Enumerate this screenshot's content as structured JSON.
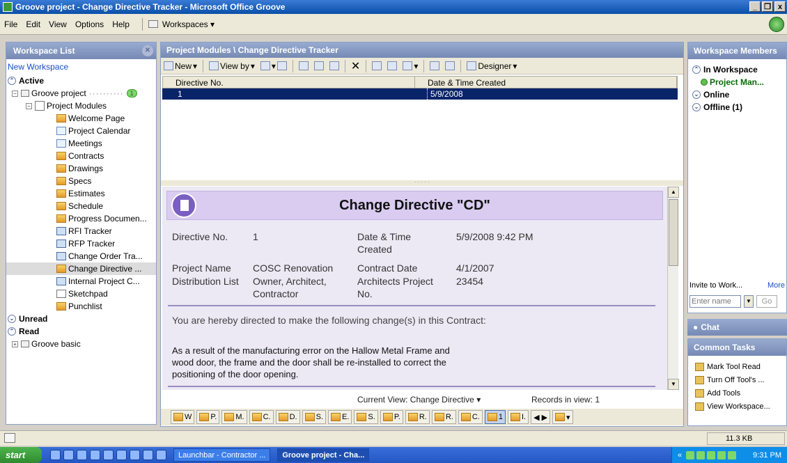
{
  "window": {
    "title": "Groove project - Change Directive Tracker - Microsoft Office Groove",
    "controls": [
      "_",
      "❐",
      "x"
    ]
  },
  "menu": {
    "items": [
      {
        "label": "File"
      },
      {
        "label": "Edit"
      },
      {
        "label": "View"
      },
      {
        "label": "Options"
      },
      {
        "label": "Help"
      }
    ],
    "workspaces_label": "Workspaces ▾"
  },
  "left": {
    "title": "Workspace List",
    "new_workspace": "New Workspace",
    "active_label": "Active",
    "project": "Groove project",
    "project_badge": "1",
    "modules_label": "Project Modules",
    "modules": [
      {
        "label": "Welcome Page",
        "icon": "tool-icon"
      },
      {
        "label": "Project Calendar",
        "icon": "calendar-icon"
      },
      {
        "label": "Meetings",
        "icon": "meetings-icon"
      },
      {
        "label": "Contracts",
        "icon": "tool-icon"
      },
      {
        "label": "Drawings",
        "icon": "tool-icon"
      },
      {
        "label": "Specs",
        "icon": "tool-icon"
      },
      {
        "label": "Estimates",
        "icon": "tool-icon"
      },
      {
        "label": "Schedule",
        "icon": "tool-icon"
      },
      {
        "label": "Progress Documen...",
        "icon": "tool-icon"
      },
      {
        "label": "RFI Tracker",
        "icon": "form-icon"
      },
      {
        "label": "RFP Tracker",
        "icon": "form-icon"
      },
      {
        "label": "Change Order Tra...",
        "icon": "form-icon"
      },
      {
        "label": "Change Directive ...",
        "icon": "tool-icon"
      },
      {
        "label": "Internal Project C...",
        "icon": "form-icon"
      },
      {
        "label": "Sketchpad",
        "icon": "sketchpad-icon"
      },
      {
        "label": "Punchlist",
        "icon": "tool-icon"
      }
    ],
    "unread_label": "Unread",
    "read_label": "Read",
    "read_item": "Groove basic"
  },
  "center": {
    "title": "Project Modules \\ Change Directive Tracker",
    "toolbar": {
      "new_label": "New",
      "viewby_label": "View by",
      "designer_label": "Designer"
    },
    "grid": {
      "columns": [
        "Directive No.",
        "Date & Time Created"
      ],
      "rows": [
        [
          "1",
          "5/9/2008"
        ]
      ]
    },
    "form": {
      "title": "Change Directive \"CD\"",
      "directive_label": "Directive No.",
      "directive_value": "1",
      "datetime_label_1": "Date & Time",
      "datetime_label_2": "Created",
      "datetime_value": "5/9/2008 9:42 PM",
      "project_label": "Project Name",
      "project_value": "COSC Renovation",
      "contract_label": "Contract Date",
      "contract_value": "4/1/2007",
      "dist_label": "Distribution List",
      "dist_value_1": "Owner, Architect,",
      "dist_value_2": "Contractor",
      "arch_label_1": "Architects Project",
      "arch_label_2": "No.",
      "arch_value": "23454",
      "directive_text": "You are hereby directed to make the following change(s) in this Contract:",
      "change_text": "As a result of the manufacturing error on the Hallow Metal Frame and wood door, the frame and the door shall be re-installed to correct the positioning of the door opening."
    },
    "current_view": "Current View: Change Directive ▾",
    "records": "Records in view: 1",
    "tabs": [
      "W",
      "P.",
      "M.",
      "C.",
      "D.",
      "S.",
      "E.",
      "S.",
      "P.",
      "R.",
      "R.",
      "C.",
      "1",
      "I."
    ]
  },
  "right": {
    "title": "Workspace Members",
    "in_workspace": "In Workspace",
    "member": "Project Man...",
    "online": "Online",
    "offline": "Offline (1)",
    "invite": "Invite to Work...",
    "more": "More",
    "enter_name": "Enter name",
    "go": "Go",
    "chat": "Chat",
    "common_tasks": "Common Tasks",
    "tasks": [
      "Mark Tool Read",
      "Turn Off Tool's ...",
      "Add Tools",
      "View Workspace..."
    ]
  },
  "statusbar": {
    "size": "11.3 KB"
  },
  "taskbar": {
    "start": "start",
    "buttons": [
      "Launchbar - Contractor ...",
      "Groove project - Cha..."
    ],
    "clock": "9:31 PM",
    "tray_arrow": "«"
  }
}
